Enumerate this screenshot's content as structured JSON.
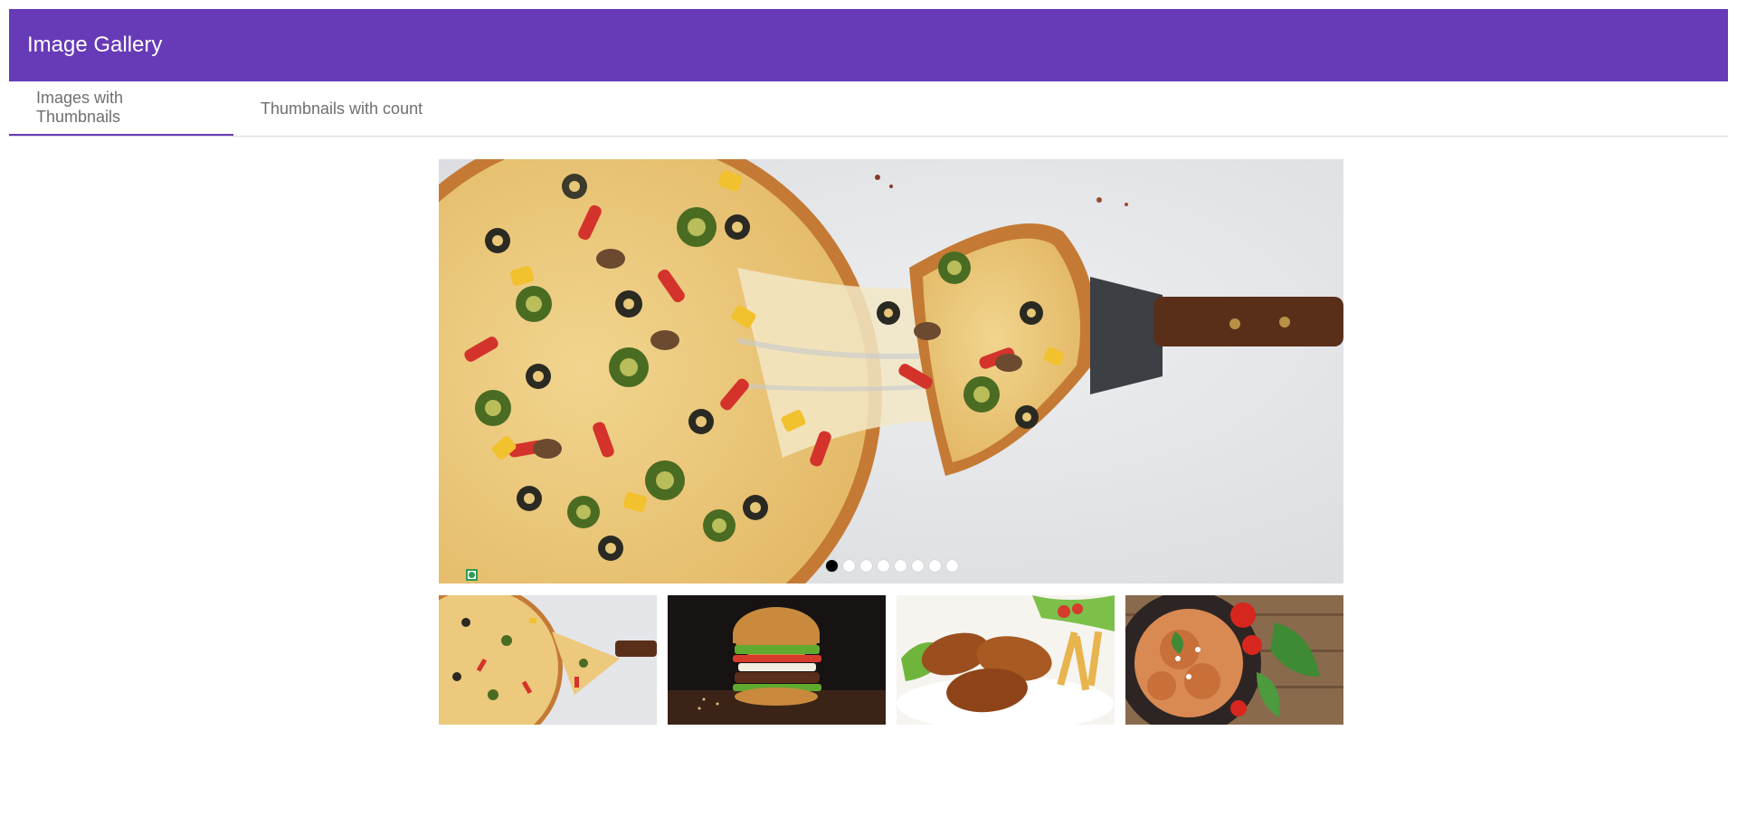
{
  "app": {
    "title": "Image Gallery"
  },
  "tabs": [
    {
      "label": "Images with Thumbnails",
      "active": true
    },
    {
      "label": "Thumbnails with count",
      "active": false
    }
  ],
  "carousel": {
    "slide_count": 8,
    "active_index": 0
  },
  "thumbnails": [
    {
      "subject": "pizza"
    },
    {
      "subject": "burger"
    },
    {
      "subject": "chicken-drumsticks"
    },
    {
      "subject": "spaghetti"
    }
  ],
  "colors": {
    "header_bg": "#673ab7",
    "tab_underline": "#673ab7",
    "veg_mark": "#2e9c52"
  }
}
